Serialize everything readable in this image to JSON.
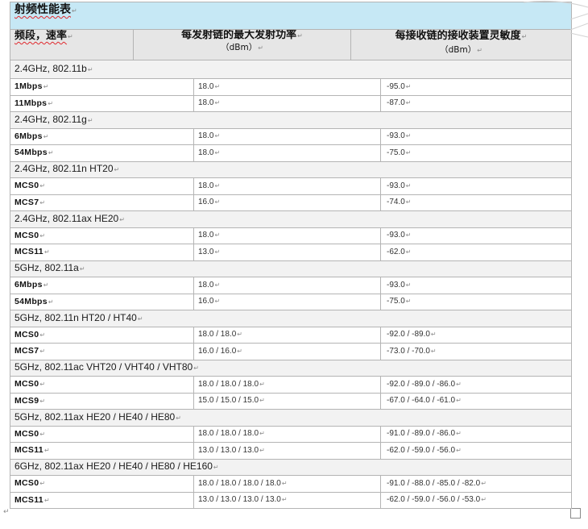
{
  "document": {
    "title": "射频性能表",
    "paragraph_mark": "↵",
    "headers": {
      "band_rate": "频段，速率",
      "tx_power_label": "每发射链的最大发射功率",
      "tx_power_unit": "（dBm）",
      "rx_sensitivity_label": "每接收链的接收装置灵敏度",
      "rx_sensitivity_unit": "（dBm）"
    },
    "groups": [
      {
        "band": "2.4GHz, 802.11b",
        "rows": [
          {
            "rate": "1Mbps",
            "tx_power_dbm": "18.0",
            "rx_sensitivity_dbm": "-95.0"
          },
          {
            "rate": "11Mbps",
            "tx_power_dbm": "18.0",
            "rx_sensitivity_dbm": "-87.0"
          }
        ]
      },
      {
        "band": "2.4GHz, 802.11g",
        "rows": [
          {
            "rate": "6Mbps",
            "tx_power_dbm": "18.0",
            "rx_sensitivity_dbm": "-93.0"
          },
          {
            "rate": "54Mbps",
            "tx_power_dbm": "18.0",
            "rx_sensitivity_dbm": "-75.0"
          }
        ]
      },
      {
        "band": "2.4GHz, 802.11n HT20",
        "rows": [
          {
            "rate": "MCS0",
            "tx_power_dbm": "18.0",
            "rx_sensitivity_dbm": "-93.0"
          },
          {
            "rate": "MCS7",
            "tx_power_dbm": "16.0",
            "rx_sensitivity_dbm": "-74.0"
          }
        ]
      },
      {
        "band": "2.4GHz, 802.11ax HE20",
        "rows": [
          {
            "rate": "MCS0",
            "tx_power_dbm": "18.0",
            "rx_sensitivity_dbm": "-93.0"
          },
          {
            "rate": "MCS11",
            "tx_power_dbm": "13.0",
            "rx_sensitivity_dbm": "-62.0"
          }
        ]
      },
      {
        "band": "5GHz, 802.11a",
        "rows": [
          {
            "rate": "6Mbps",
            "tx_power_dbm": "18.0",
            "rx_sensitivity_dbm": "-93.0"
          },
          {
            "rate": "54Mbps",
            "tx_power_dbm": "16.0",
            "rx_sensitivity_dbm": "-75.0"
          }
        ]
      },
      {
        "band": "5GHz, 802.11n HT20 / HT40",
        "rows": [
          {
            "rate": "MCS0",
            "tx_power_dbm": "18.0 / 18.0",
            "rx_sensitivity_dbm": "-92.0 / -89.0"
          },
          {
            "rate": "MCS7",
            "tx_power_dbm": "16.0 / 16.0",
            "rx_sensitivity_dbm": "-73.0 / -70.0"
          }
        ]
      },
      {
        "band": "5GHz, 802.11ac VHT20 / VHT40 / VHT80",
        "rows": [
          {
            "rate": "MCS0",
            "tx_power_dbm": "18.0 / 18.0 / 18.0",
            "rx_sensitivity_dbm": "-92.0 / -89.0 / -86.0"
          },
          {
            "rate": "MCS9",
            "tx_power_dbm": "15.0 / 15.0 / 15.0",
            "rx_sensitivity_dbm": "-67.0 / -64.0 / -61.0"
          }
        ]
      },
      {
        "band": "5GHz, 802.11ax HE20 / HE40 / HE80",
        "rows": [
          {
            "rate": "MCS0",
            "tx_power_dbm": "18.0 / 18.0 / 18.0",
            "rx_sensitivity_dbm": "-91.0 / -89.0 / -86.0"
          },
          {
            "rate": "MCS11",
            "tx_power_dbm": "13.0 / 13.0 / 13.0",
            "rx_sensitivity_dbm": "-62.0 / -59.0 / -56.0"
          }
        ]
      },
      {
        "band": "6GHz, 802.11ax HE20 / HE40 / HE80 / HE160",
        "rows": [
          {
            "rate": "MCS0",
            "tx_power_dbm": "18.0 / 18.0 / 18.0 / 18.0",
            "rx_sensitivity_dbm": "-91.0 / -88.0 / -85.0 / -82.0"
          },
          {
            "rate": "MCS11",
            "tx_power_dbm": "13.0 / 13.0 / 13.0 / 13.0",
            "rx_sensitivity_dbm": "-62.0 / -59.0 / -56.0 / -53.0"
          }
        ]
      }
    ]
  },
  "colors": {
    "title_background": "#c6e8f5",
    "header_background": "#e6e6e6",
    "band_row_background": "#f2f2f2",
    "cell_border": "#b4b4b4",
    "spellcheck_underline": "#e0282d",
    "formatting_mark": "#8c8c8c"
  },
  "icons": {
    "paragraph_mark": "paragraph-mark-icon",
    "table_resize_handle": "table-resize-handle-icon"
  }
}
